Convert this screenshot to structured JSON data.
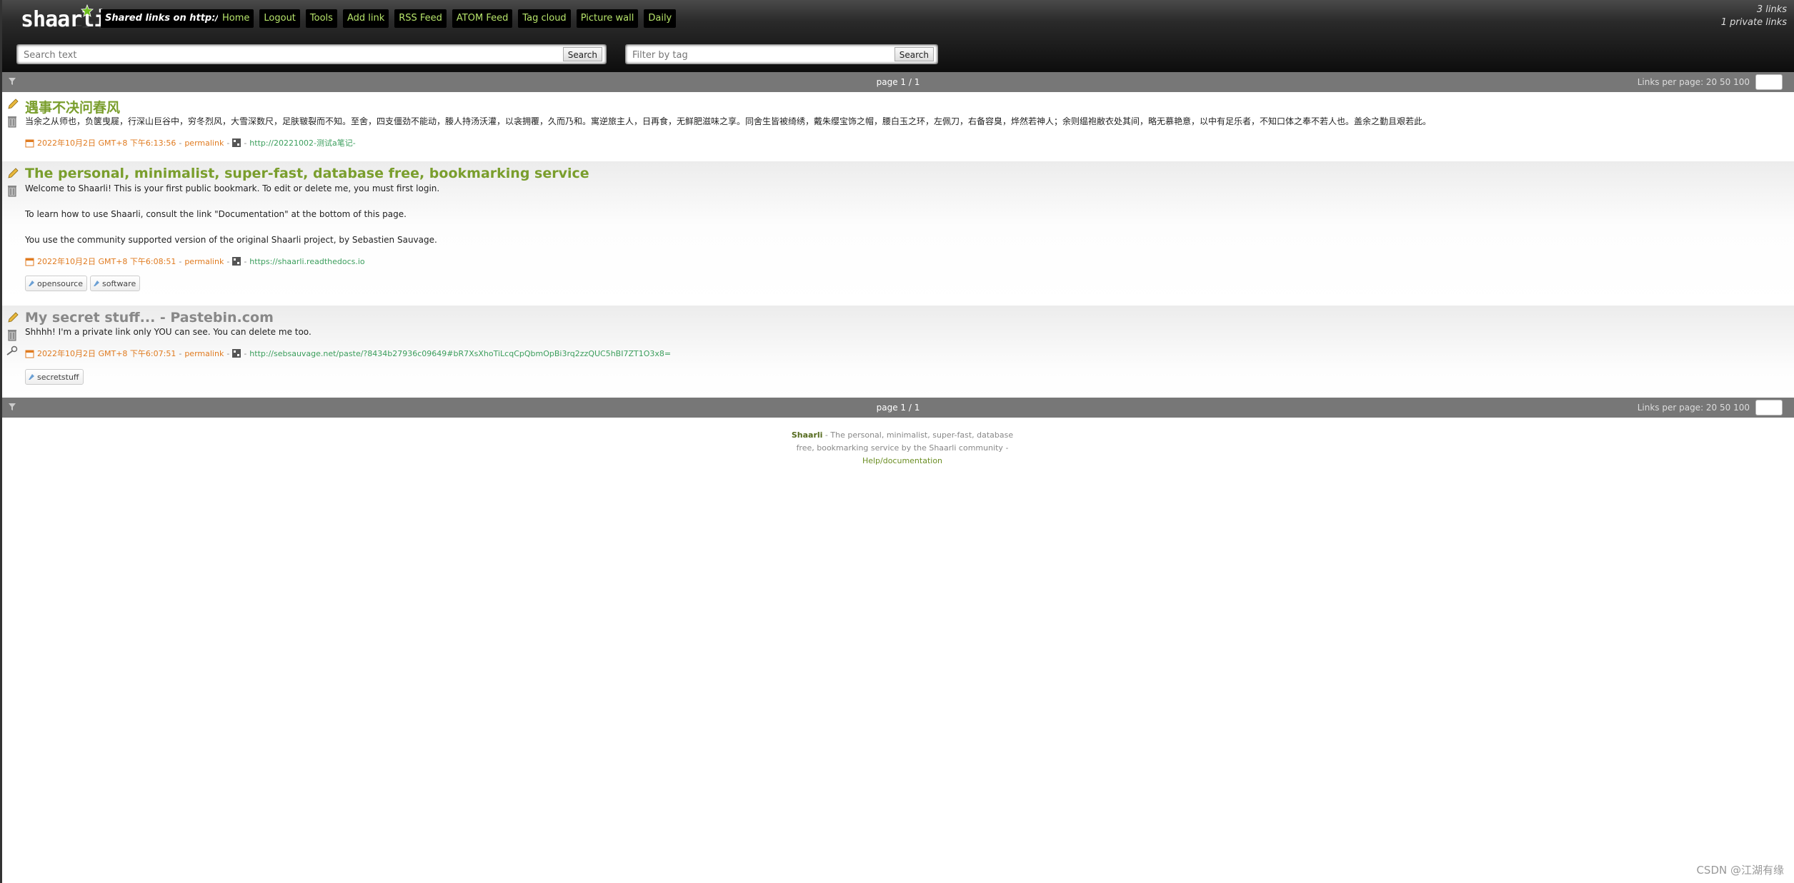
{
  "header": {
    "logo": "shaarli",
    "title": "Shared links on http:///",
    "nav": [
      "Home",
      "Logout",
      "Tools",
      "Add link",
      "RSS Feed",
      "ATOM Feed",
      "Tag cloud",
      "Picture wall",
      "Daily"
    ],
    "count_links": "3 links",
    "count_private": "1 private links",
    "search": {
      "placeholder": "Search text",
      "button": "Search"
    },
    "tag_filter": {
      "placeholder": "Filter by tag",
      "button": "Search"
    }
  },
  "paging": {
    "label": "page 1 / 1",
    "links_per_page": "Links per page: 20 50 100"
  },
  "links": [
    {
      "title": "遇事不决问春风",
      "description": "当余之从师也，负箧曳屣，行深山巨谷中，穷冬烈风，大雪深数尺，足肤皲裂而不知。至舍，四支僵劲不能动，媵人持汤沃灌，以衾拥覆，久而乃和。寓逆旅主人，日再食，无鲜肥滋味之享。同舍生皆被绮绣，戴朱缨宝饰之帽，腰白玉之环，左佩刀，右备容臭，烨然若神人；余则缊袍敝衣处其间，略无慕艳意，以中有足乐者，不知口体之奉不若人也。盖余之勤且艰若此。",
      "date": "2022年10月2日 GMT+8 下午6:13:56",
      "permalink": "permalink",
      "url": "http://20221002-测试a笔记-",
      "tags": []
    },
    {
      "title": "The personal, minimalist, super-fast, database free, bookmarking service",
      "description_lines": [
        "Welcome to Shaarli! This is your first public bookmark. To edit or delete me, you must first login.",
        "To learn how to use Shaarli, consult the link \"Documentation\" at the bottom of this page.",
        "You use the community supported version of the original Shaarli project, by Sebastien Sauvage."
      ],
      "date": "2022年10月2日 GMT+8 下午6:08:51",
      "permalink": "permalink",
      "url": "https://shaarli.readthedocs.io",
      "tags": [
        "opensource",
        "software"
      ]
    },
    {
      "title": "My secret stuff... - Pastebin.com",
      "description": "Shhhh! I'm a private link only YOU can see. You can delete me too.",
      "date": "2022年10月2日 GMT+8 下午6:07:51",
      "permalink": "permalink",
      "url": "http://sebsauvage.net/paste/?8434b27936c09649#bR7XsXhoTiLcqCpQbmOpBi3rq2zzQUC5hBI7ZT1O3x8=",
      "tags": [
        "secretstuff"
      ]
    }
  ],
  "footer": {
    "brand": "Shaarli",
    "text": " - The personal, minimalist, super-fast, database free, bookmarking service by the Shaarli community - ",
    "help": "Help/documentation"
  },
  "watermark": "CSDN @江湖有缘",
  "colors": {
    "accent": "#7a9e2d",
    "nav_text": "#b6e36a",
    "date": "#e07b20",
    "url": "#3b9e5c"
  }
}
